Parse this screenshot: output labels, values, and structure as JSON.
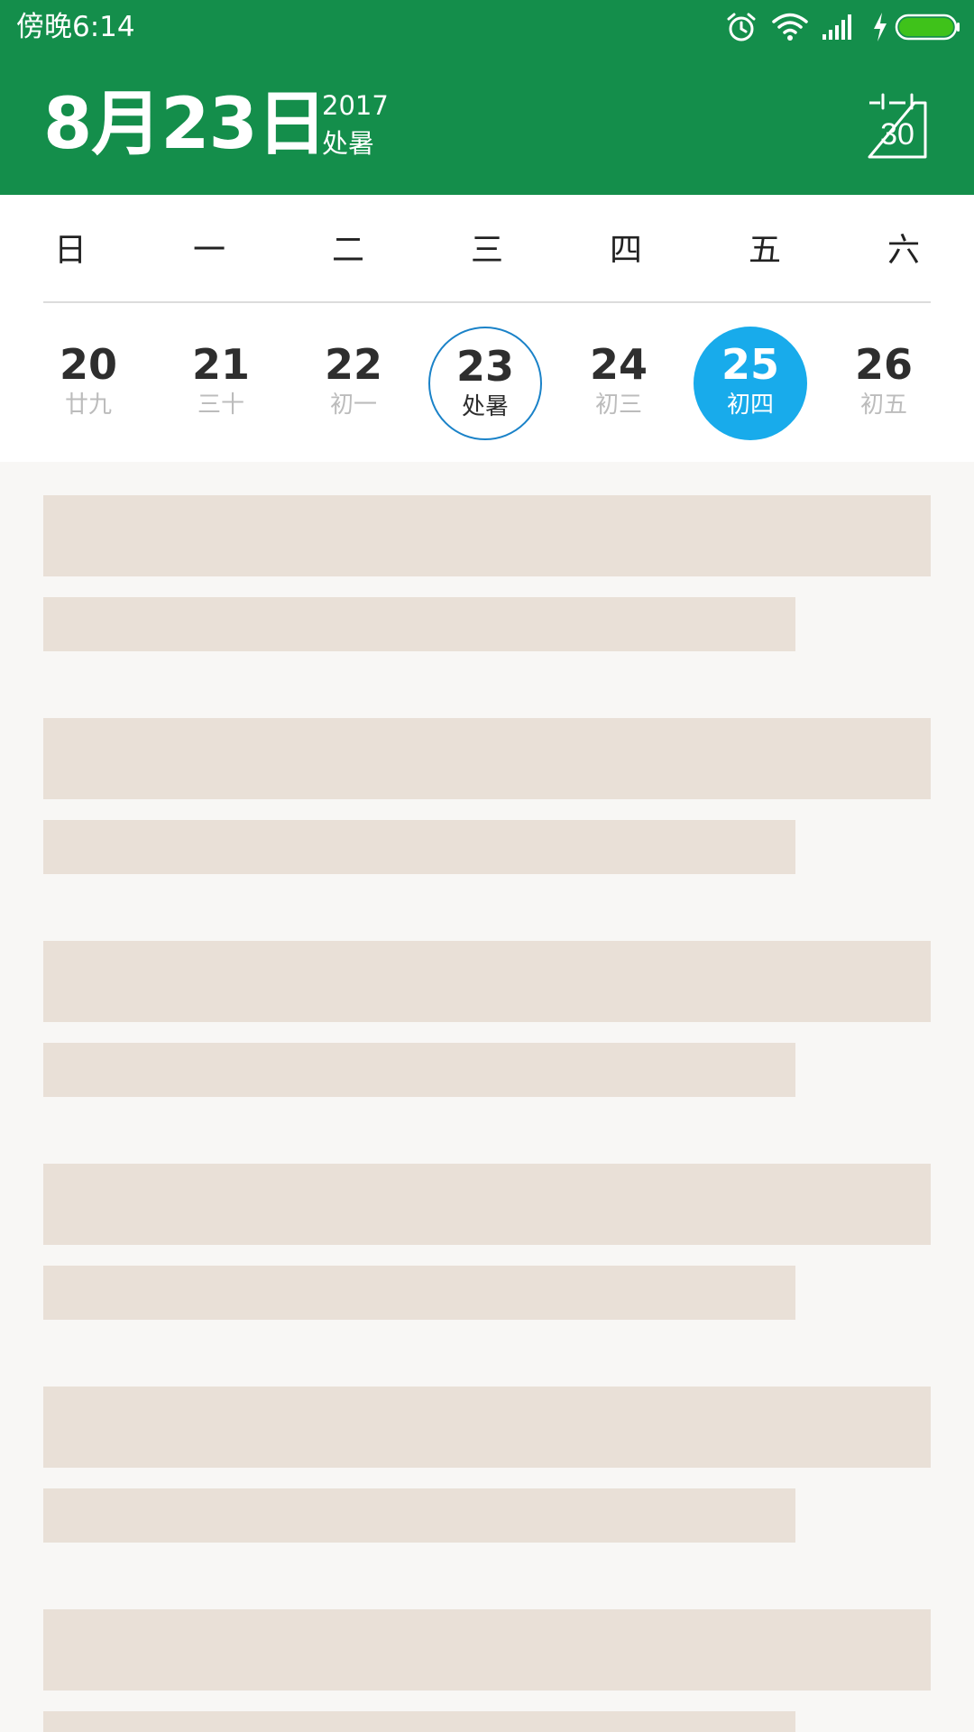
{
  "status_bar": {
    "time": "傍晚6:14",
    "icons": [
      "alarm-icon",
      "wifi-icon",
      "signal-icon",
      "charging-icon",
      "battery-icon"
    ],
    "battery_color": "#3fc21a"
  },
  "header": {
    "date": "8月23日",
    "year": "2017",
    "solar_term": "处暑",
    "calendar_button_day": "30",
    "background_color": "#148e4b"
  },
  "week": {
    "weekdays": [
      "日",
      "一",
      "二",
      "三",
      "四",
      "五",
      "六"
    ],
    "days": [
      {
        "num": "20",
        "lunar": "廿九",
        "state": "normal"
      },
      {
        "num": "21",
        "lunar": "三十",
        "state": "normal"
      },
      {
        "num": "22",
        "lunar": "初一",
        "state": "normal"
      },
      {
        "num": "23",
        "lunar": "处暑",
        "state": "today"
      },
      {
        "num": "24",
        "lunar": "初三",
        "state": "normal"
      },
      {
        "num": "25",
        "lunar": "初四",
        "state": "selected"
      },
      {
        "num": "26",
        "lunar": "初五",
        "state": "normal"
      }
    ],
    "today_ring_color": "#1a82c8",
    "selected_fill_color": "#18abeb"
  },
  "content": {
    "placeholder_color": "#e9e0d7",
    "placeholder_groups": 6
  }
}
